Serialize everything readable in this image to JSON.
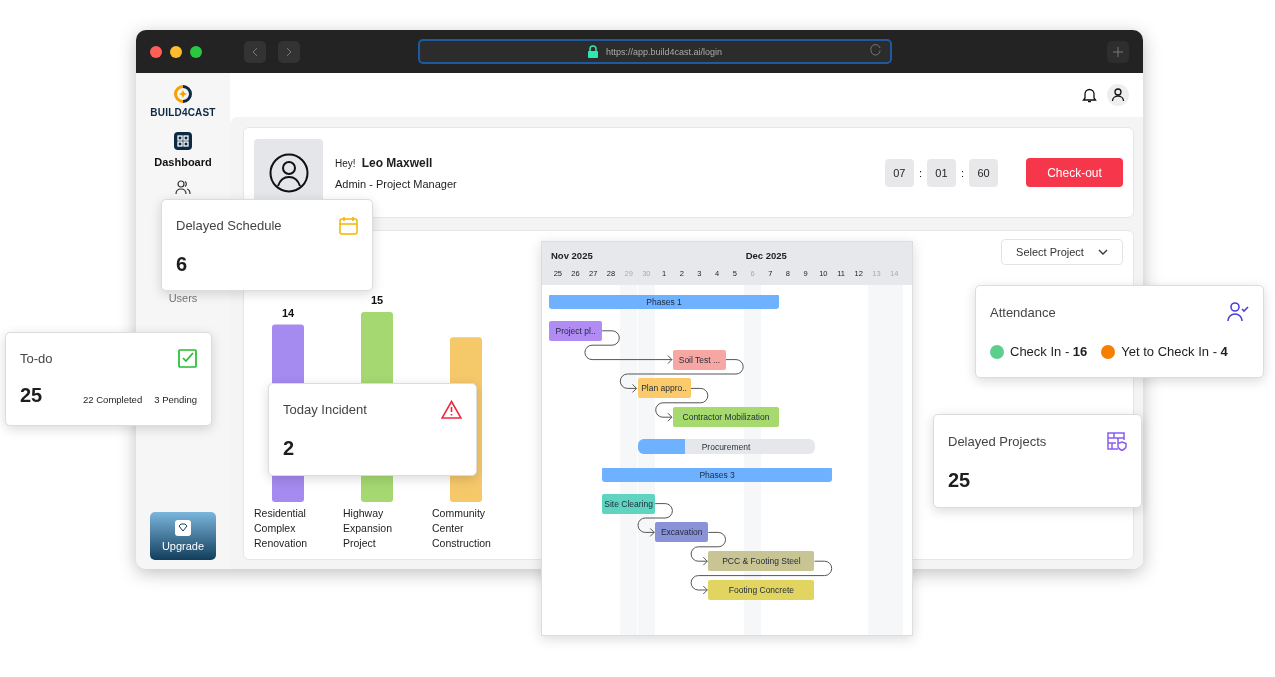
{
  "browser": {
    "url": "https://app.build4cast.ai/login"
  },
  "sidebar": {
    "logo": "BUILD4CAST",
    "upgrade": "Upgrade",
    "items": [
      {
        "label": "Dashboard",
        "selected": true
      },
      {
        "selected": false
      },
      {
        "label": "Users",
        "selected": false
      }
    ]
  },
  "profile": {
    "greeting": "Hey!",
    "name": "Leo Maxwell",
    "role": "Admin - Project Manager",
    "timer": [
      {
        "kind": "digit",
        "text": "07"
      },
      {
        "kind": "sep",
        "text": ":"
      },
      {
        "kind": "digit",
        "text": "01"
      },
      {
        "kind": "sep",
        "text": ":"
      },
      {
        "kind": "digit",
        "text": "60"
      }
    ],
    "checkout": "Check-out"
  },
  "project_select": {
    "label": "Select Project"
  },
  "chart": {
    "chart_data": {
      "type": "bar",
      "categories": [
        "Residential Complex Renovation",
        "Highway Expansion Project",
        "Community Center Construction"
      ],
      "values": [
        14,
        15,
        13
      ],
      "colors": [
        "#a58af0",
        "#a6d872",
        "#f5c86a"
      ],
      "value_labels": [
        "14",
        "15",
        null
      ]
    }
  },
  "delayed_schedule": {
    "title": "Delayed Schedule",
    "value": "6"
  },
  "todo": {
    "title": "To-do",
    "value": "25",
    "completed": "22",
    "completed_label": "Completed",
    "pending": "3",
    "pending_label": "Pending"
  },
  "today_incident": {
    "title": "Today Incident",
    "value": "2"
  },
  "attendance": {
    "title": "Attendance",
    "items": [
      {
        "text": "Check In - **16**",
        "color": "#5ccf8f"
      },
      {
        "text": "Yet to Check In - **4**",
        "color": "#f77f00"
      }
    ]
  },
  "delayed_projects": {
    "title": "Delayed Projects",
    "value": "25"
  },
  "gantt": {
    "months": [
      {
        "label": "Nov 2025"
      },
      {
        "label": "Dec 2025"
      }
    ],
    "days": [
      {
        "label": "25",
        "weekend": false
      },
      {
        "label": "26",
        "weekend": false
      },
      {
        "label": "27",
        "weekend": false
      },
      {
        "label": "28",
        "weekend": false
      },
      {
        "label": "29",
        "weekend": true
      },
      {
        "label": "30",
        "weekend": true
      },
      {
        "label": "1",
        "weekend": false
      },
      {
        "label": "2",
        "weekend": false
      },
      {
        "label": "3",
        "weekend": false
      },
      {
        "label": "4",
        "weekend": false
      },
      {
        "label": "5",
        "weekend": false
      },
      {
        "label": "6",
        "weekend": true
      },
      {
        "label": "7",
        "weekend": false
      },
      {
        "label": "8",
        "weekend": false
      },
      {
        "label": "9",
        "weekend": false
      },
      {
        "label": "10",
        "weekend": false
      },
      {
        "label": "11",
        "weekend": false
      },
      {
        "label": "12",
        "weekend": false
      },
      {
        "label": "13",
        "weekend": true
      },
      {
        "label": "14",
        "weekend": true
      }
    ],
    "tasks": [
      {
        "kind": "phase",
        "label": "Phases 1",
        "color": "#6eb1ff"
      },
      {
        "kind": "task",
        "label": "Project pl..",
        "color": "#b18cf5",
        "linked": false
      },
      {
        "kind": "task",
        "label": "Soil Test ...",
        "color": "#f7a7a3",
        "linked": true
      },
      {
        "kind": "task",
        "label": "Plan appro..",
        "color": "#fbcb6b",
        "linked": true
      },
      {
        "kind": "task",
        "label": "Contractor Mobilization",
        "color": "#a6d96e",
        "linked": true
      },
      {
        "kind": "progress",
        "label": "Procurement",
        "level": 0.27
      },
      {
        "kind": "phase",
        "label": "Phases 3",
        "color": "#6eb1ff"
      },
      {
        "kind": "task",
        "label": "Site Clearing",
        "color": "#5fd5c0",
        "linked": false
      },
      {
        "kind": "task",
        "label": "Excavation",
        "color": "#8b93d8",
        "linked": true
      },
      {
        "kind": "task",
        "label": "PCC & Footing Steel",
        "color": "#c9c493",
        "linked": true
      },
      {
        "kind": "task",
        "label": "Footing Concrete",
        "color": "#e2d461",
        "linked": true
      }
    ]
  }
}
